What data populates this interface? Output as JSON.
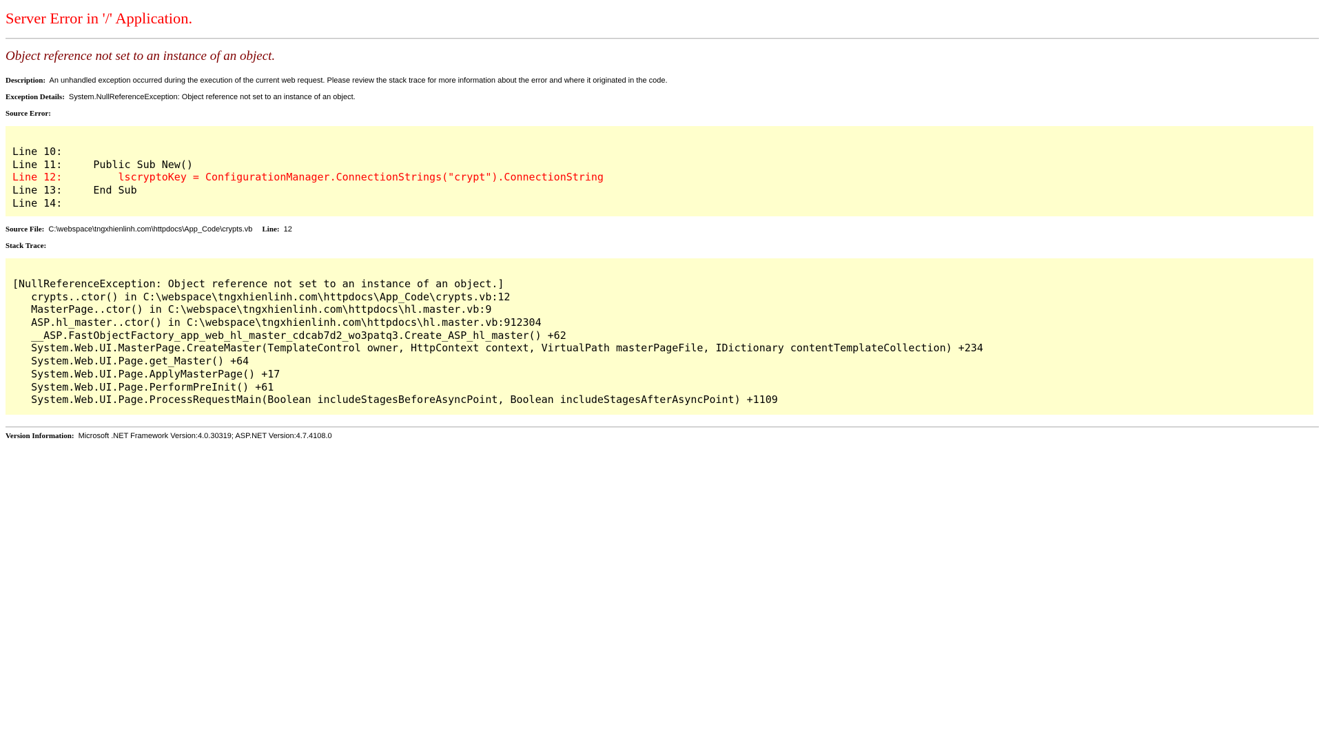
{
  "page": {
    "title": "Server Error in '/' Application.",
    "subtitle": "Object reference not set to an instance of an object."
  },
  "description": {
    "label": "Description:",
    "text": "An unhandled exception occurred during the execution of the current web request. Please review the stack trace for more information about the error and where it originated in the code."
  },
  "exception": {
    "label": "Exception Details:",
    "text": "System.NullReferenceException: Object reference not set to an instance of an object."
  },
  "source_error": {
    "label": "Source Error:",
    "lines": [
      {
        "text": "Line 10:",
        "highlight": false
      },
      {
        "text": "Line 11:     Public Sub New()",
        "highlight": false
      },
      {
        "text": "Line 12:         lscryptoKey = ConfigurationManager.ConnectionStrings(\"crypt\").ConnectionString",
        "highlight": true
      },
      {
        "text": "Line 13:     End Sub",
        "highlight": false
      },
      {
        "text": "Line 14:",
        "highlight": false
      }
    ]
  },
  "source_file": {
    "label": "Source File:",
    "path": "C:\\webspace\\tngxhienlinh.com\\httpdocs\\App_Code\\crypts.vb",
    "line_label": "Line:",
    "line_value": "12"
  },
  "stack_trace": {
    "label": "Stack Trace:",
    "lines": [
      "[NullReferenceException: Object reference not set to an instance of an object.]",
      "   crypts..ctor() in C:\\webspace\\tngxhienlinh.com\\httpdocs\\App_Code\\crypts.vb:12",
      "   MasterPage..ctor() in C:\\webspace\\tngxhienlinh.com\\httpdocs\\hl.master.vb:9",
      "   ASP.hl_master..ctor() in C:\\webspace\\tngxhienlinh.com\\httpdocs\\hl.master.vb:912304",
      "   __ASP.FastObjectFactory_app_web_hl_master_cdcab7d2_wo3patq3.Create_ASP_hl_master() +62",
      "   System.Web.UI.MasterPage.CreateMaster(TemplateControl owner, HttpContext context, VirtualPath masterPageFile, IDictionary contentTemplateCollection) +234",
      "   System.Web.UI.Page.get_Master() +64",
      "   System.Web.UI.Page.ApplyMasterPage() +17",
      "   System.Web.UI.Page.PerformPreInit() +61",
      "   System.Web.UI.Page.ProcessRequestMain(Boolean includeStagesBeforeAsyncPoint, Boolean includeStagesAfterAsyncPoint) +1109"
    ]
  },
  "version": {
    "label": "Version Information:",
    "text": "Microsoft .NET Framework Version:4.0.30319; ASP.NET Version:4.7.4108.0"
  },
  "colors": {
    "title": "#ff0000",
    "subtitle": "#800000",
    "code_background": "#ffffcc",
    "highlight_line": "#ff0000"
  }
}
